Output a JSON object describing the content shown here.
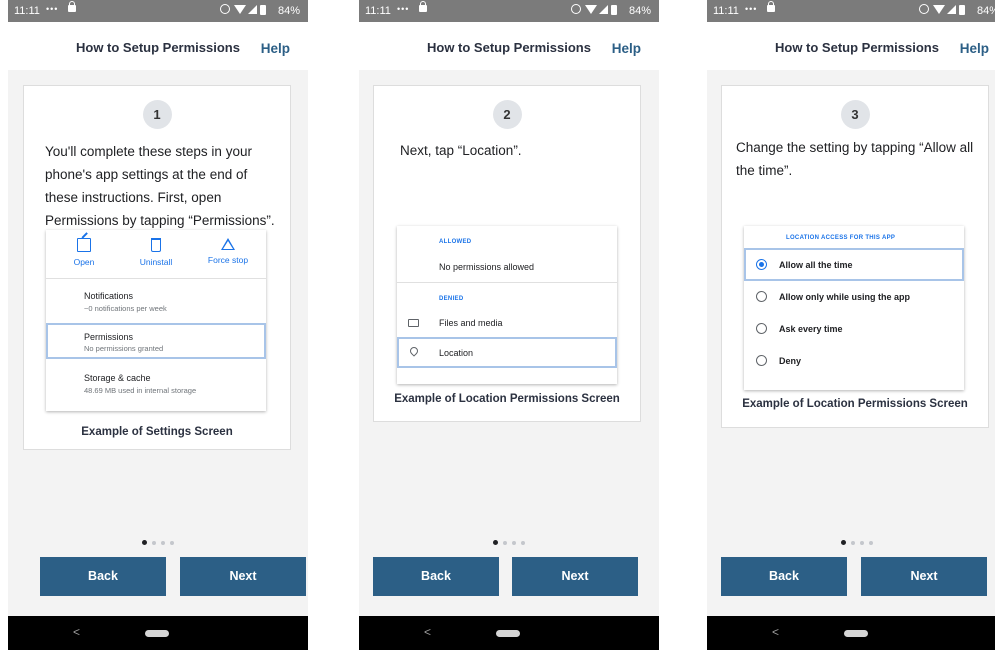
{
  "colors": {
    "accent": "#2c5f86",
    "link_blue": "#1a73e8",
    "highlight": "#a8c4e8",
    "status_bar": "#7b7b7b",
    "screen_background": "#f3f3f3"
  },
  "status": {
    "time": "11:11",
    "battery": "84%"
  },
  "header": {
    "title": "How to Setup Permissions",
    "help_label": "Help"
  },
  "buttons": {
    "back_label": "Back",
    "next_label": "Next"
  },
  "nav": {
    "back_icon": "chevron-left-icon",
    "home_icon": "home-pill-icon"
  },
  "pager": {
    "total": 4,
    "active": 1
  },
  "screens": [
    {
      "step": "1",
      "instruction": "You'll complete these steps in your phone's app settings at the end of these instructions. First, open Permissions by tapping “Permissions”.",
      "caption": "Example of Settings Screen",
      "mock": {
        "actions": [
          {
            "label": "Open",
            "icon": "open-icon"
          },
          {
            "label": "Uninstall",
            "icon": "trash-icon"
          },
          {
            "label": "Force stop",
            "icon": "warning-icon"
          }
        ],
        "rows": [
          {
            "title": "Notifications",
            "subtitle": "~0 notifications per week"
          },
          {
            "title": "Permissions",
            "subtitle": "No permissions granted",
            "highlighted": true
          },
          {
            "title": "Storage & cache",
            "subtitle": "48.69 MB used in internal storage"
          }
        ]
      }
    },
    {
      "step": "2",
      "instruction": "Next, tap “Location”.",
      "caption": "Example of Location Permissions Screen",
      "mock": {
        "allowed_header": "ALLOWED",
        "allowed_text": "No permissions allowed",
        "denied_header": "DENIED",
        "denied_items": [
          {
            "label": "Files and media",
            "icon": "folder-icon"
          },
          {
            "label": "Location",
            "icon": "location-pin-icon",
            "highlighted": true
          }
        ]
      }
    },
    {
      "step": "3",
      "instruction": "Change the setting by tapping “Allow all the time”.",
      "caption": "Example of Location Permissions Screen",
      "mock": {
        "header": "LOCATION ACCESS FOR THIS APP",
        "options": [
          {
            "label": "Allow all the time",
            "selected": true
          },
          {
            "label": "Allow only while using the app",
            "selected": false
          },
          {
            "label": "Ask every time",
            "selected": false
          },
          {
            "label": "Deny",
            "selected": false
          }
        ]
      }
    }
  ]
}
